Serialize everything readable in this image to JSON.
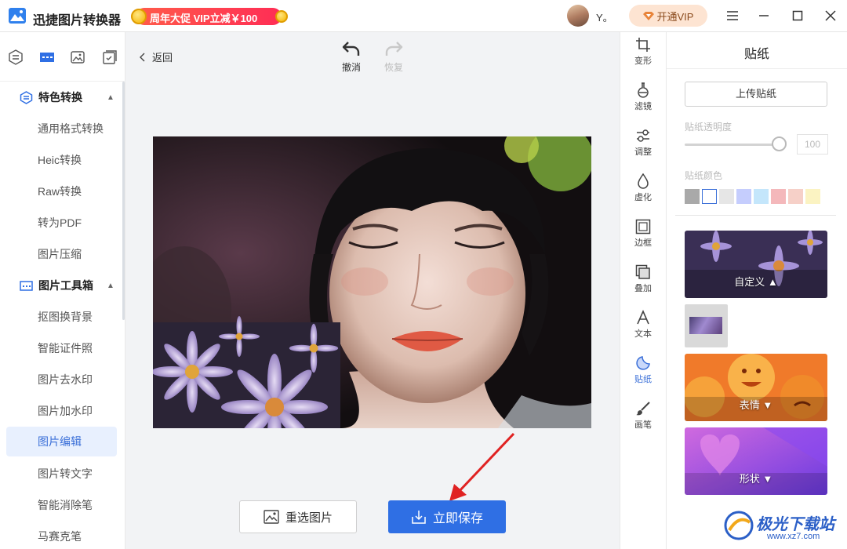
{
  "titlebar": {
    "app_title": "迅捷图片转换器",
    "promo_text": "周年大促 VIP立减￥100",
    "username": "Y。",
    "vip_label": "开通VIP"
  },
  "sidebar": {
    "sections": [
      {
        "label": "特色转换",
        "items": [
          "通用格式转换",
          "Heic转换",
          "Raw转换",
          "转为PDF",
          "图片压缩"
        ]
      },
      {
        "label": "图片工具箱",
        "items": [
          "抠图换背景",
          "智能证件照",
          "图片去水印",
          "图片加水印",
          "图片编辑",
          "图片转文字",
          "智能消除笔",
          "马赛克笔"
        ]
      }
    ],
    "active_item": "图片编辑"
  },
  "editor": {
    "back_label": "返回",
    "undo_label": "撤消",
    "redo_label": "恢复",
    "reselect_label": "重选图片",
    "save_label": "立即保存"
  },
  "toolstrip": {
    "items": [
      {
        "label": "变形",
        "icon": "crop-icon"
      },
      {
        "label": "滤镜",
        "icon": "flask-icon"
      },
      {
        "label": "调整",
        "icon": "sliders-icon"
      },
      {
        "label": "虚化",
        "icon": "drop-icon"
      },
      {
        "label": "边框",
        "icon": "frame-icon"
      },
      {
        "label": "叠加",
        "icon": "layers-icon"
      },
      {
        "label": "文本",
        "icon": "text-icon"
      },
      {
        "label": "贴纸",
        "icon": "sticker-icon"
      },
      {
        "label": "画笔",
        "icon": "brush-icon"
      }
    ],
    "active": "贴纸"
  },
  "panel": {
    "title": "贴纸",
    "upload_label": "上传贴纸",
    "opacity_label": "贴纸透明度",
    "opacity_value": "100",
    "opacity_level": 1.0,
    "color_label": "贴纸颜色",
    "swatches": [
      "#a9a9a9",
      "#ffffff",
      "#e6e6e6",
      "#c5cdfd",
      "#c4e6fb",
      "#f4b8bb",
      "#f6d0c8",
      "#fbf3c2"
    ],
    "categories": [
      {
        "label": "自定义",
        "icon": "caret-up-icon"
      },
      {
        "label": "表情",
        "icon": "caret-down-icon"
      },
      {
        "label": "形状",
        "icon": "caret-down-icon"
      }
    ]
  },
  "watermark": {
    "name": "极光下载站",
    "url": "www.xz7.com"
  }
}
